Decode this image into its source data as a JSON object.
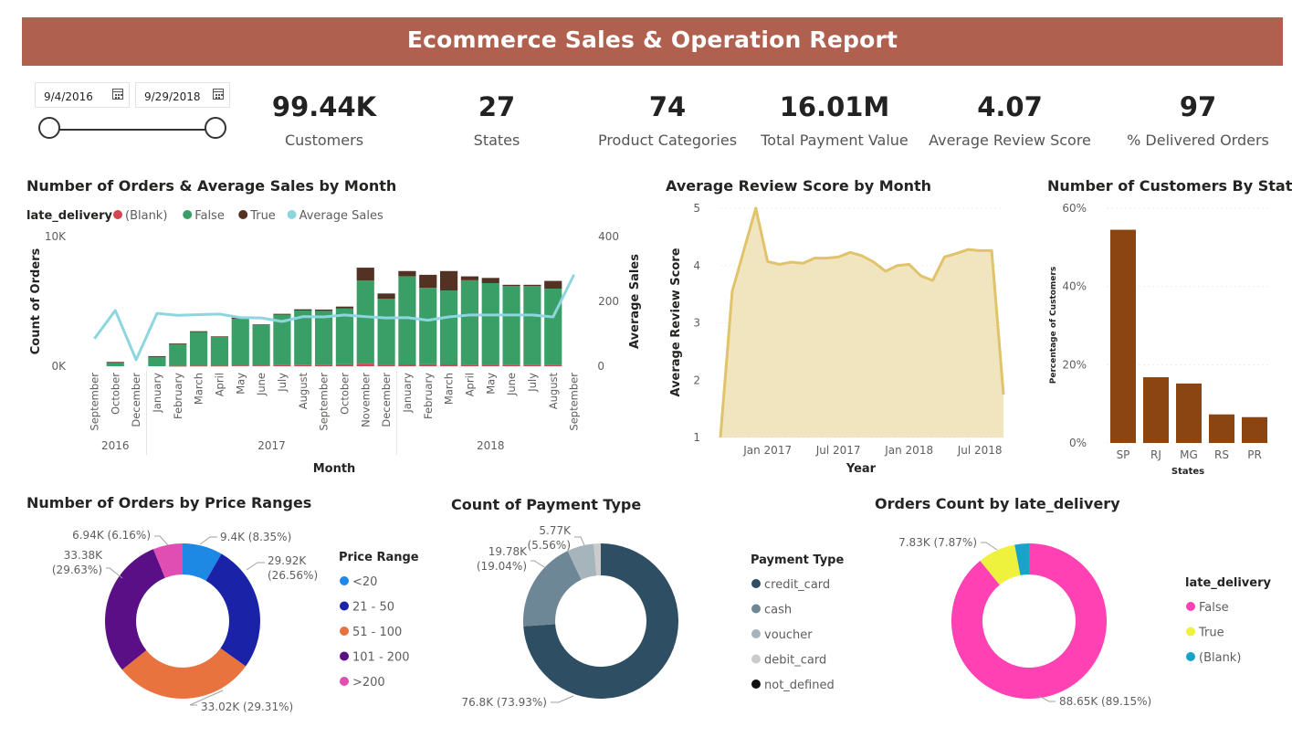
{
  "title": "Ecommerce Sales & Operation Report",
  "filters": {
    "start_date": "9/4/2016",
    "end_date": "9/29/2018"
  },
  "kpis": [
    {
      "value": "99.44K",
      "label": "Customers"
    },
    {
      "value": "27",
      "label": "States"
    },
    {
      "value": "74",
      "label": "Product Categories"
    },
    {
      "value": "16.01M",
      "label": "Total Payment Value"
    },
    {
      "value": "4.07",
      "label": "Average Review Score"
    },
    {
      "value": "97",
      "label": "% Delivered Orders"
    }
  ],
  "colors": {
    "banner": "#b0604e",
    "false": "#3a9e67",
    "true": "#533123",
    "blank": "#d64550",
    "avg_sales": "#8ed6df",
    "area_fill": "#f0e5bf",
    "area_line": "#e0c36a",
    "state_bar": "#8b4513"
  },
  "chart_data": [
    {
      "type": "bar",
      "title": "Number of Orders & Average Sales by Month",
      "legend_title": "late_delivery",
      "legend": [
        "(Blank)",
        "False",
        "True",
        "Average Sales"
      ],
      "xlabel": "Month",
      "ylabel": "Count of Orders",
      "y2label": "Average Sales",
      "ylim": [
        0,
        10000
      ],
      "y_ticks": [
        "0K",
        "10K"
      ],
      "y2lim": [
        0,
        400
      ],
      "y2_ticks": [
        "0",
        "200",
        "400"
      ],
      "categories": [
        "September",
        "October",
        "December",
        "January",
        "February",
        "March",
        "April",
        "May",
        "June",
        "July",
        "August",
        "September",
        "October",
        "November",
        "December",
        "January",
        "February",
        "March",
        "April",
        "May",
        "June",
        "July",
        "August",
        "September"
      ],
      "years": [
        {
          "label": "2016",
          "from": 0,
          "to": 2
        },
        {
          "label": "2017",
          "from": 3,
          "to": 14
        },
        {
          "label": "2018",
          "from": 15,
          "to": 23
        }
      ],
      "series": [
        {
          "name": "(Blank)",
          "values": [
            0,
            0,
            0,
            0,
            30,
            40,
            40,
            60,
            60,
            80,
            90,
            120,
            150,
            200,
            110,
            140,
            150,
            140,
            130,
            110,
            80,
            80,
            80,
            0
          ]
        },
        {
          "name": "False",
          "values": [
            0,
            300,
            0,
            750,
            1700,
            2600,
            2200,
            3600,
            3100,
            3900,
            4200,
            4150,
            4300,
            6400,
            5100,
            6800,
            5900,
            5700,
            6500,
            6300,
            6100,
            6100,
            5900,
            0
          ]
        },
        {
          "name": "True",
          "values": [
            0,
            30,
            0,
            30,
            20,
            60,
            60,
            100,
            60,
            60,
            100,
            100,
            150,
            1000,
            400,
            400,
            1000,
            1500,
            300,
            400,
            100,
            100,
            600,
            0
          ]
        },
        {
          "name": "Average Sales",
          "values": [
            85,
            172,
            20,
            163,
            157,
            159,
            161,
            150,
            149,
            138,
            153,
            152,
            158,
            153,
            149,
            150,
            142,
            152,
            158,
            158,
            158,
            158,
            152,
            282
          ]
        }
      ]
    },
    {
      "type": "area",
      "title": "Average Review Score by Month",
      "xlabel": "Year",
      "ylabel": "Average Review Score",
      "ylim": [
        1,
        5
      ],
      "y_ticks": [
        "1",
        "2",
        "3",
        "4",
        "5"
      ],
      "x_ticks": [
        "Jan 2017",
        "Jul 2017",
        "Jan 2018",
        "Jul 2018"
      ],
      "x": [
        "2016-09",
        "2016-10",
        "2016-12",
        "2017-01",
        "2017-02",
        "2017-03",
        "2017-04",
        "2017-05",
        "2017-06",
        "2017-07",
        "2017-08",
        "2017-09",
        "2017-10",
        "2017-11",
        "2017-12",
        "2018-01",
        "2018-02",
        "2018-03",
        "2018-04",
        "2018-05",
        "2018-06",
        "2018-07",
        "2018-08",
        "2018-09"
      ],
      "values": [
        1.0,
        3.55,
        5.0,
        4.07,
        4.02,
        4.06,
        4.04,
        4.13,
        4.13,
        4.15,
        4.23,
        4.17,
        4.06,
        3.9,
        4.0,
        4.02,
        3.82,
        3.74,
        4.15,
        4.21,
        4.28,
        4.26,
        4.26,
        1.75
      ]
    },
    {
      "type": "bar",
      "title": "Number of Customers By State",
      "xlabel": "States",
      "ylabel": "Percentage of Customers",
      "ylim": [
        0,
        60
      ],
      "y_ticks": [
        "0%",
        "20%",
        "40%",
        "60%"
      ],
      "categories": [
        "SP",
        "RJ",
        "MG",
        "RS",
        "PR"
      ],
      "values": [
        54.5,
        16.8,
        15.2,
        7.3,
        6.6
      ]
    },
    {
      "type": "pie",
      "title": "Number of Orders by Price Ranges",
      "legend_title": "Price Range",
      "categories": [
        "<20",
        "21 - 50",
        "51 - 100",
        "101 - 200",
        ">200"
      ],
      "values": [
        9.4,
        29.92,
        33.02,
        33.38,
        6.94
      ],
      "percents": [
        8.35,
        26.56,
        29.31,
        29.63,
        6.16
      ],
      "colors": [
        "#1e88e5",
        "#1a23a8",
        "#e8733f",
        "#5a0f87",
        "#e04eb3"
      ],
      "labels": [
        "9.4K (8.35%)",
        "29.92K\n(26.56%)",
        "33.02K (29.31%)",
        "33.38K\n(29.63%)",
        "6.94K (6.16%)"
      ]
    },
    {
      "type": "pie",
      "title": "Count of Payment Type",
      "legend_title": "Payment Type",
      "categories": [
        "credit_card",
        "cash",
        "voucher",
        "debit_card",
        "not_defined"
      ],
      "values": [
        76.8,
        19.78,
        5.77,
        1.53,
        0.003
      ],
      "percents": [
        73.93,
        19.04,
        5.56,
        1.47,
        0.0
      ],
      "colors": [
        "#2d4e63",
        "#6d8796",
        "#a6b4bc",
        "#cbcbcb",
        "#111111"
      ],
      "labels": [
        "76.8K (73.93%)",
        "19.78K\n(19.04%)",
        "5.77K\n(5.56%)",
        "",
        ""
      ]
    },
    {
      "type": "pie",
      "title": "Orders Count by late_delivery",
      "legend_title": "late_delivery",
      "categories": [
        "False",
        "True",
        "(Blank)"
      ],
      "values": [
        88.65,
        7.83,
        2.96
      ],
      "percents": [
        89.15,
        7.87,
        2.98
      ],
      "colors": [
        "#ff41b4",
        "#eef23d",
        "#1aa3c9"
      ],
      "labels": [
        "88.65K (89.15%)",
        "7.83K (7.87%)",
        ""
      ]
    }
  ]
}
